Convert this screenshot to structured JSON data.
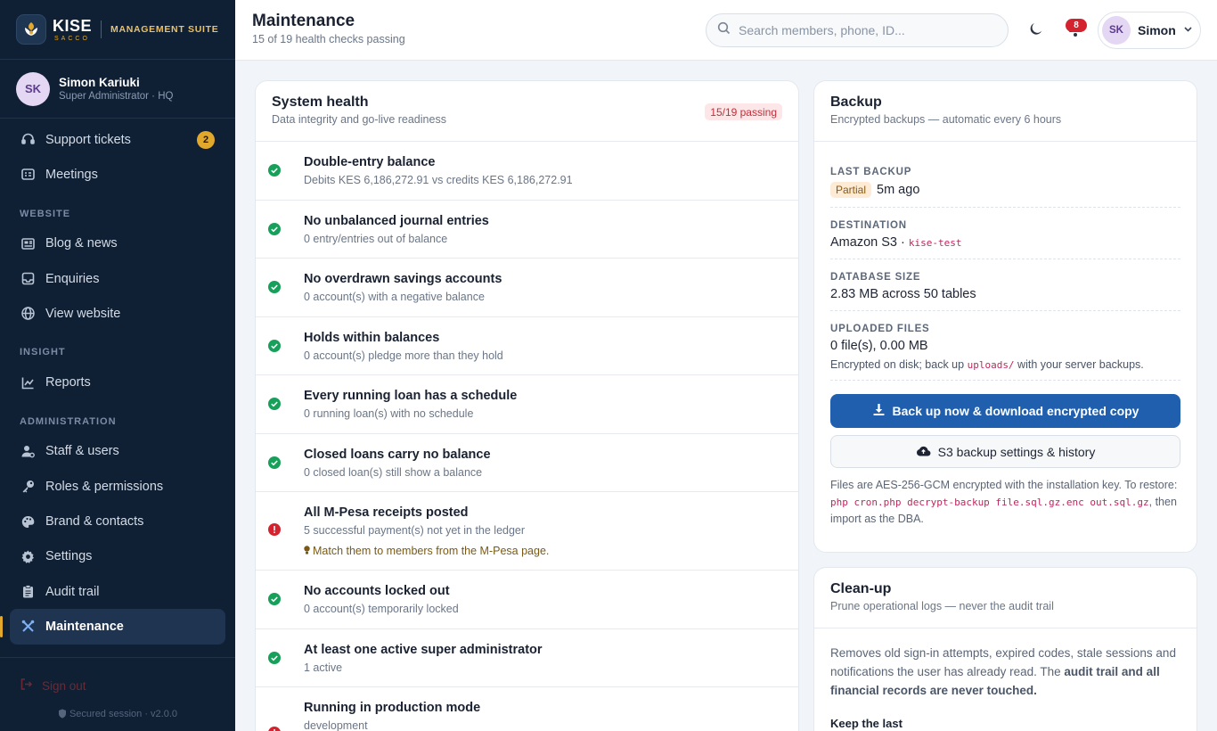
{
  "brand": {
    "name": "KISE",
    "tagline": "SACCO",
    "suite": "MANAGEMENT SUITE"
  },
  "profile": {
    "initials": "SK",
    "name": "Simon Kariuki",
    "role": "Super Administrator · HQ"
  },
  "nav": {
    "support": {
      "label": "Support tickets",
      "badge": "2"
    },
    "meetings": {
      "label": "Meetings"
    },
    "section_website": "WEBSITE",
    "blog": {
      "label": "Blog & news"
    },
    "enquiries": {
      "label": "Enquiries"
    },
    "view_website": {
      "label": "View website"
    },
    "section_insight": "INSIGHT",
    "reports": {
      "label": "Reports"
    },
    "section_admin": "ADMINISTRATION",
    "staff": {
      "label": "Staff & users"
    },
    "roles": {
      "label": "Roles & permissions"
    },
    "brand_contacts": {
      "label": "Brand & contacts"
    },
    "settings": {
      "label": "Settings"
    },
    "audit": {
      "label": "Audit trail"
    },
    "maintenance": {
      "label": "Maintenance"
    },
    "signout": "Sign out",
    "secured": "Secured session · v2.0.0"
  },
  "header": {
    "title": "Maintenance",
    "subtitle": "15 of 19 health checks passing",
    "search_placeholder": "Search members, phone, ID...",
    "notifications": "8",
    "user_initials": "SK",
    "user_name": "Simon"
  },
  "health": {
    "title": "System health",
    "subtitle": "Data integrity and go-live readiness",
    "badge": "15/19 passing",
    "checks": [
      {
        "status": "pass",
        "title": "Double-entry balance",
        "detail": "Debits KES 6,186,272.91 vs credits KES 6,186,272.91"
      },
      {
        "status": "pass",
        "title": "No unbalanced journal entries",
        "detail": "0 entry/entries out of balance"
      },
      {
        "status": "pass",
        "title": "No overdrawn savings accounts",
        "detail": "0 account(s) with a negative balance"
      },
      {
        "status": "pass",
        "title": "Holds within balances",
        "detail": "0 account(s) pledge more than they hold"
      },
      {
        "status": "pass",
        "title": "Every running loan has a schedule",
        "detail": "0 running loan(s) with no schedule"
      },
      {
        "status": "pass",
        "title": "Closed loans carry no balance",
        "detail": "0 closed loan(s) still show a balance"
      },
      {
        "status": "fail",
        "title": "All M-Pesa receipts posted",
        "detail": "5 successful payment(s) not yet in the ledger",
        "hint": "Match them to members from the M-Pesa page."
      },
      {
        "status": "pass",
        "title": "No accounts locked out",
        "detail": "0 account(s) temporarily locked"
      },
      {
        "status": "pass",
        "title": "At least one active super administrator",
        "detail": "1 active"
      },
      {
        "status": "fail",
        "title": "Running in production mode",
        "detail": "development"
      }
    ]
  },
  "backup": {
    "title": "Backup",
    "subtitle": "Encrypted backups — automatic every 6 hours",
    "last_label": "LAST BACKUP",
    "last_badge": "Partial",
    "last_value": "5m ago",
    "dest_label": "DESTINATION",
    "dest_value": "Amazon S3 ·",
    "dest_bucket": "kise-test",
    "db_label": "DATABASE SIZE",
    "db_value": "2.83 MB across 50 tables",
    "files_label": "UPLOADED FILES",
    "files_value": "0 file(s), 0.00 MB",
    "files_note_a": "Encrypted on disk; back up",
    "files_note_code": "uploads/",
    "files_note_b": "with your server backups.",
    "btn_backup": "Back up now & download encrypted copy",
    "btn_s3": "S3 backup settings & history",
    "foot_a": "Files are AES-256-GCM encrypted with the installation key. To restore:",
    "foot_code": "php cron.php decrypt-backup file.sql.gz.enc out.sql.gz",
    "foot_b": ", then import as the DBA."
  },
  "cleanup": {
    "title": "Clean-up",
    "subtitle": "Prune operational logs — never the audit trail",
    "body_a": "Removes old sign-in attempts, expired codes, stale sessions and notifications the user has already read. The",
    "body_bold": "audit trail and all financial records are never touched.",
    "keep_label": "Keep the last"
  },
  "colors": {
    "sidebar": "#0f2035",
    "accent_gold": "#e2a82c",
    "primary": "#1f5fad",
    "pass": "#16a05a",
    "fail": "#d4232e"
  }
}
